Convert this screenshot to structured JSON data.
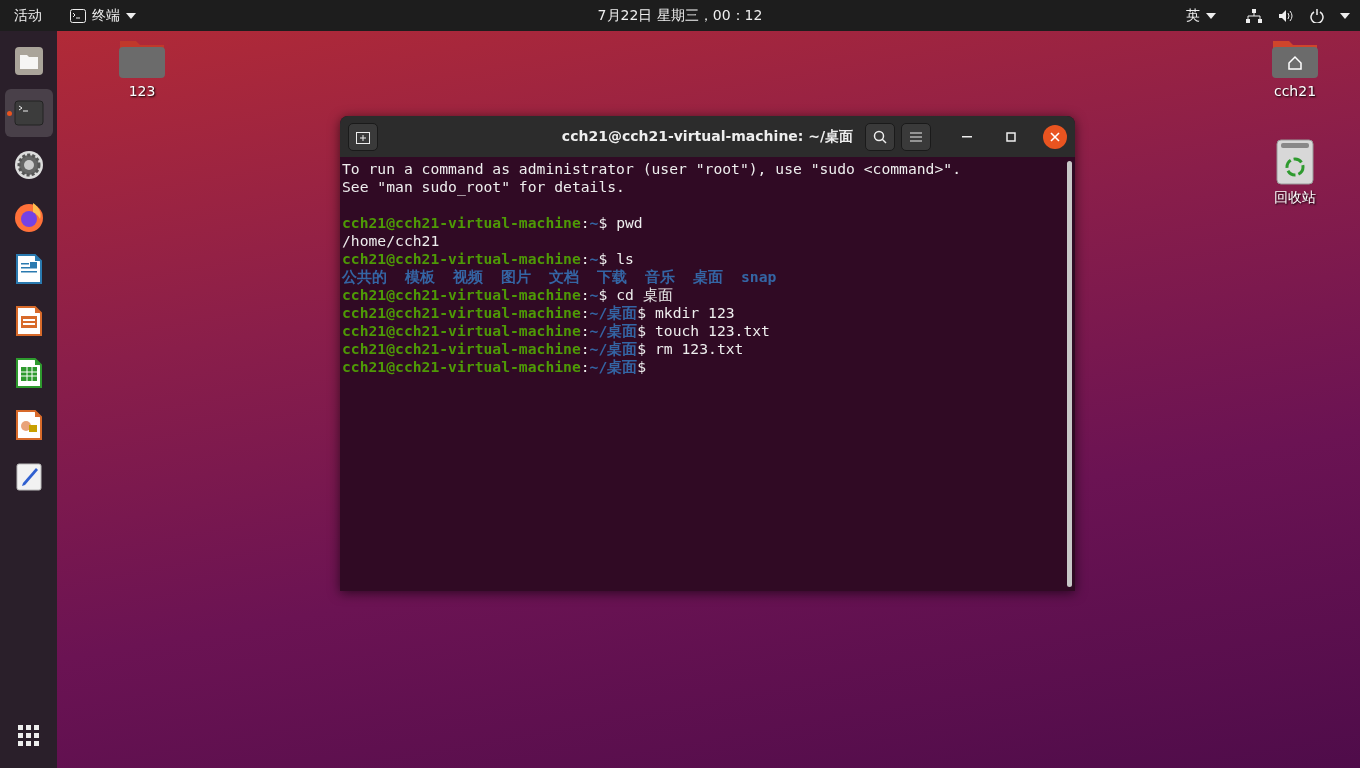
{
  "top_bar": {
    "activities": "活动",
    "app_menu": "终端",
    "clock": "7月22日 星期三，00：12",
    "input_method": "英"
  },
  "dock": {
    "items": [
      {
        "kind": "files",
        "running": false,
        "selected": false
      },
      {
        "kind": "terminal",
        "running": true,
        "selected": true
      },
      {
        "kind": "settings",
        "running": false,
        "selected": false
      },
      {
        "kind": "firefox",
        "running": false,
        "selected": false
      },
      {
        "kind": "writer",
        "running": false,
        "selected": false
      },
      {
        "kind": "impress",
        "running": false,
        "selected": false
      },
      {
        "kind": "calc",
        "running": false,
        "selected": false
      },
      {
        "kind": "draw",
        "running": false,
        "selected": false
      },
      {
        "kind": "editor",
        "running": false,
        "selected": false
      }
    ]
  },
  "desktop_icons": [
    {
      "kind": "folder",
      "label": "123"
    },
    {
      "kind": "home",
      "label": "cch21"
    },
    {
      "kind": "trash",
      "label": "回收站"
    }
  ],
  "terminal": {
    "title": "cch21@cch21-virtual-machine: ~/桌面",
    "lines": [
      {
        "kind": "output",
        "text": "To run a command as administrator (user \"root\"), use \"sudo <command>\"."
      },
      {
        "kind": "output",
        "text": "See \"man sudo_root\" for details."
      },
      {
        "kind": "blank"
      },
      {
        "kind": "prompt",
        "user": "cch21@cch21-virtual-machine",
        "separator": ":",
        "path": "~",
        "symbol": "$",
        "command": "pwd"
      },
      {
        "kind": "output",
        "text": "/home/cch21"
      },
      {
        "kind": "prompt",
        "user": "cch21@cch21-virtual-machine",
        "separator": ":",
        "path": "~",
        "symbol": "$",
        "command": "ls"
      },
      {
        "kind": "listing",
        "items": [
          "公共的",
          "模板",
          "视频",
          "图片",
          "文档",
          "下载",
          "音乐",
          "桌面",
          "snap"
        ]
      },
      {
        "kind": "prompt",
        "user": "cch21@cch21-virtual-machine",
        "separator": ":",
        "path": "~",
        "symbol": "$",
        "command": "cd 桌面"
      },
      {
        "kind": "prompt",
        "user": "cch21@cch21-virtual-machine",
        "separator": ":",
        "path": "~/桌面",
        "symbol": "$",
        "command": "mkdir 123"
      },
      {
        "kind": "prompt",
        "user": "cch21@cch21-virtual-machine",
        "separator": ":",
        "path": "~/桌面",
        "symbol": "$",
        "command": "touch 123.txt"
      },
      {
        "kind": "prompt",
        "user": "cch21@cch21-virtual-machine",
        "separator": ":",
        "path": "~/桌面",
        "symbol": "$",
        "command": "rm 123.txt"
      },
      {
        "kind": "prompt",
        "user": "cch21@cch21-virtual-machine",
        "separator": ":",
        "path": "~/桌面",
        "symbol": "$"
      }
    ]
  }
}
